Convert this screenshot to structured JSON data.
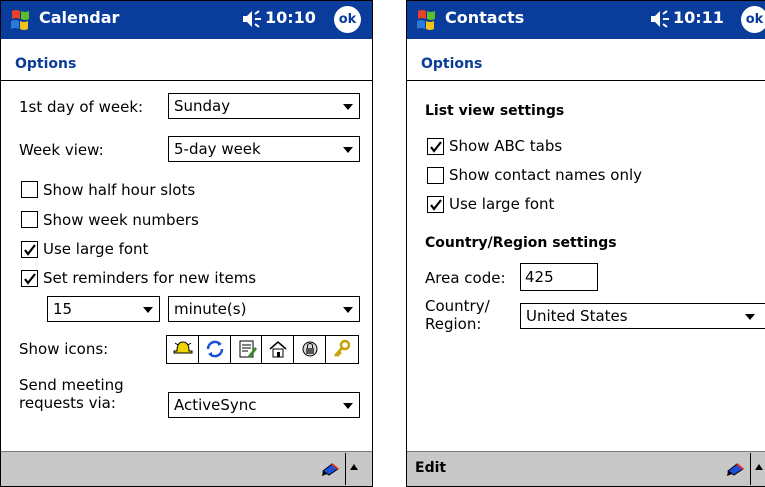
{
  "colors": {
    "title_bar": "#0a3c9c",
    "options_header": "#0a3c9c",
    "menu_bar": "#c8c8c8"
  },
  "calendar": {
    "title": "Calendar",
    "time": "10:10",
    "ok_label": "ok",
    "options_label": "Options",
    "first_day_label": "1st day of week:",
    "first_day_value": "Sunday",
    "week_view_label": "Week view:",
    "week_view_value": "5-day week",
    "half_hour_label": "Show half hour slots",
    "half_hour_checked": false,
    "week_numbers_label": "Show week numbers",
    "week_numbers_checked": false,
    "large_font_label": "Use large font",
    "large_font_checked": true,
    "reminders_label": "Set reminders for new items",
    "reminders_checked": true,
    "reminder_amount": "15",
    "reminder_unit": "minute(s)",
    "show_icons_label": "Show icons:",
    "show_icons": [
      "alarm-icon",
      "recurring-icon",
      "note-icon",
      "home-icon",
      "private-icon",
      "key-icon"
    ],
    "send_via_label_line1": "Send meeting",
    "send_via_label_line2": "requests via:",
    "send_via_value": "ActiveSync"
  },
  "contacts": {
    "title": "Contacts",
    "time": "10:11",
    "ok_label": "ok",
    "options_label": "Options",
    "list_view_header": "List view settings",
    "abc_tabs_label": "Show ABC tabs",
    "abc_tabs_checked": true,
    "names_only_label": "Show contact names only",
    "names_only_checked": false,
    "large_font_label": "Use large font",
    "large_font_checked": true,
    "region_header": "Country/Region settings",
    "area_code_label": "Area code:",
    "area_code_value": "425",
    "country_label_line1": "Country/",
    "country_label_line2": "Region:",
    "country_value": "United States",
    "edit_menu": "Edit"
  }
}
